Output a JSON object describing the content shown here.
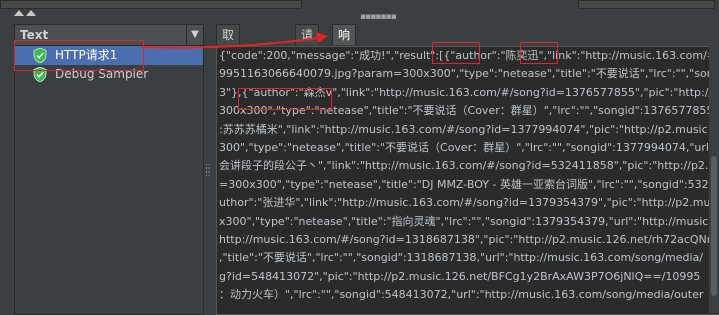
{
  "left_panel": {
    "header": "Text",
    "items": [
      {
        "label": "HTTP请求1",
        "selected": true
      },
      {
        "label": "Debug Sampler",
        "selected": false
      }
    ]
  },
  "tabs": [
    {
      "label": "取样器结果",
      "active": false
    },
    {
      "label": "请求",
      "active": false
    },
    {
      "label": "响应数据",
      "active": true
    }
  ],
  "response_lines": [
    "{\"code\":200,\"message\":\"成功!\",\"result\":[{\"author\":\"陈奕迅\",\"link\":\"http://music.163.com/#/s",
    "9951163066640079.jpg?param=300x300\",\"type\":\"netease\",\"title\":\"不要说话\",\"lrc\":\"\",\"son",
    "3\"},{\"author\":\"森杰v\",\"link\":\"http://music.163.com/#/song?id=1376577855\",\"pic\":\"http://p2",
    "300x300\",\"type\":\"netease\",\"title\":\"不要说话（Cover：群星）\",\"lrc\":\"\",\"songid\":1376577855",
    ":苏苏苏橘米\",\"link\":\"http://music.163.com/#/song?id=1377994074\",\"pic\":\"http://p2.music",
    "300\",\"type\":\"netease\",\"title\":\"不要说话（Cover：群星）\",\"lrc\":\"\",\"songid\":1377994074,\"url",
    "会讲段子的段公子丶\",\"link\":\"http://music.163.com/#/song?id=532411858\",\"pic\":\"http://p2.",
    "=300x300\",\"type\":\"netease\",\"title\":\"DJ MMZ-BOY - 英雄一亚索台词版\",\"lrc\":\"\",\"songid\":532",
    "uthor\":\"张进华\",\"link\":\"http://music.163.com/#/song?id=1379354379\",\"pic\":\"http://p2.mu",
    "x300\",\"type\":\"netease\",\"title\":\"指向灵魂\",\"lrc\":\"\",\"songid\":1379354379,\"url\":\"http://music.1",
    "http://music.163.com/#/song?id=1318687138\",\"pic\":\"http://p2.music.126.net/rh72acQNr",
    ",\"title\":\"不要说话\",\"lrc\":\"\",\"songid\":1318687138,\"url\":\"http://music.163.com/song/media/",
    "g?id=548413072\",\"pic\":\"http://p2.music.126.net/BFCg1y2BrAxAW3P7O6jNlQ==/10995",
    "：动力火车）\",\"lrc\":\"\",\"songid\":548413072,\"url\":\"http://music.163.com/song/media/outer"
  ],
  "colors": {
    "background": "#3c3f41",
    "selection": "#4b6eaf",
    "highlight_border": "#e0252b",
    "shield_green": "#2fbf4a"
  }
}
